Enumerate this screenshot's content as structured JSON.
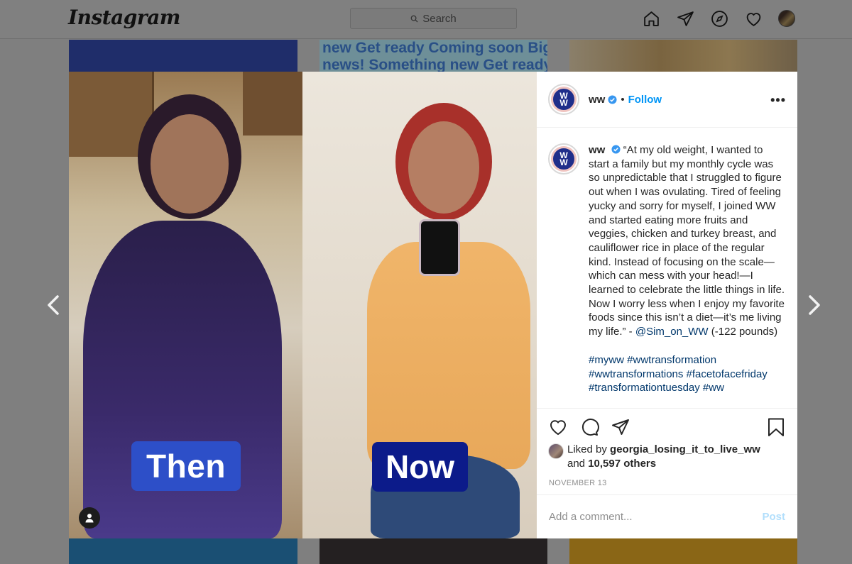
{
  "topnav": {
    "logo": "Instagram",
    "search_placeholder": "Search"
  },
  "background": {
    "teaser_line1": "new Get ready Coming soon Big",
    "teaser_line2": "news! Something new Get ready"
  },
  "post": {
    "photo_label_before": "Then",
    "photo_label_after": "Now",
    "username": "ww",
    "follow_label": "Follow",
    "caption_text": "“At my old weight, I wanted to start a family but my monthly cycle was so unpredictable that I struggled to figure out when I was ovulating. Tired of feeling yucky and sorry for myself, I joined WW and started eating more fruits and veggies, chicken and turkey breast, and cauliflower rice in place of the regular kind. Instead of focusing on the scale—which can mess with your head!—I learned to celebrate the little things in life. Now I worry less when I enjoy my favorite foods since this isn’t a diet—it’s me living my life.” -",
    "caption_mention": "@Sim_on_WW",
    "caption_suffix": "(-122 pounds)",
    "hashtags": "#myww #wwtransformation #wwtransformations #facetofacefriday #transformationtuesday #ww",
    "liked_by_prefix": "Liked by",
    "liked_by_user": "georgia_losing_it_to_live_ww",
    "likes_and": "and",
    "likes_others": "10,597 others",
    "date": "NOVEMBER 13",
    "comment_placeholder": "Add a comment...",
    "post_button": "Post"
  },
  "logo_text": "WW",
  "colors": {
    "accent_blue": "#0095f6",
    "link_dark": "#00376b",
    "then_badge": "#2d4fc8",
    "now_badge": "#0c1b8a"
  },
  "icons": [
    "home-icon",
    "direct-icon",
    "explore-icon",
    "activity-heart-icon",
    "heart-icon",
    "comment-icon",
    "share-icon",
    "bookmark-icon",
    "more-icon",
    "verified-icon",
    "user-tag-icon",
    "chevron-left-icon",
    "chevron-right-icon"
  ]
}
